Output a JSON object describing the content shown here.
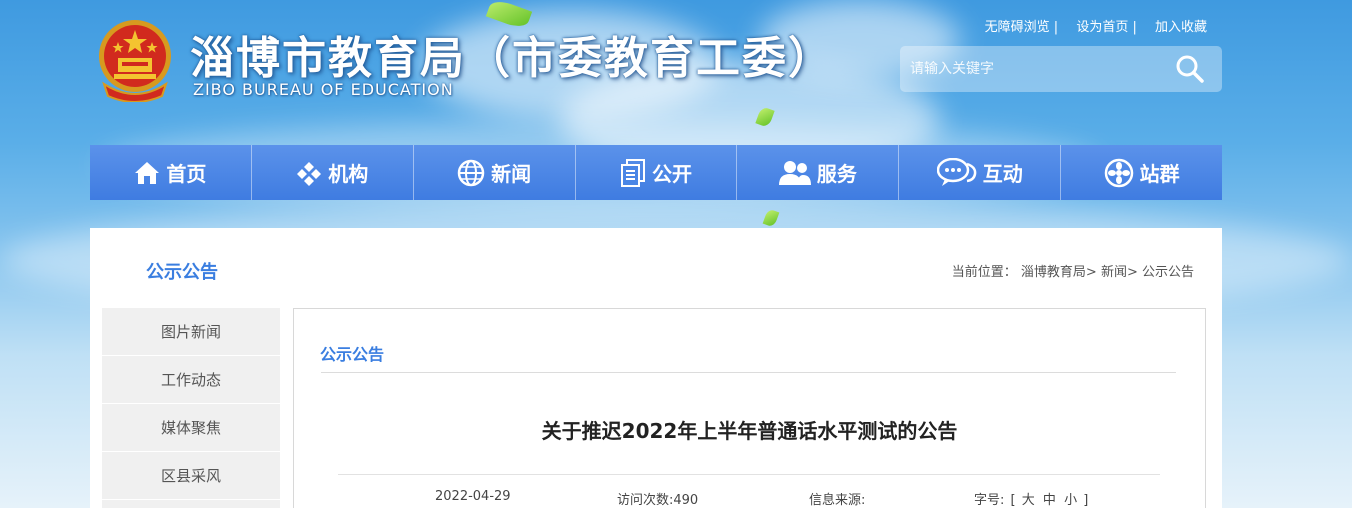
{
  "header": {
    "site_title": "淄博市教育局（市委教育工委）",
    "site_subtitle": "ZIBO BUREAU OF EDUCATION",
    "top_links": [
      "无障碍浏览 |",
      "设为首页 |",
      "加入收藏"
    ],
    "search_placeholder": "请输入关键字"
  },
  "nav": {
    "items": [
      {
        "label": "首页",
        "icon": "home-icon"
      },
      {
        "label": "机构",
        "icon": "org-icon"
      },
      {
        "label": "新闻",
        "icon": "globe-icon"
      },
      {
        "label": "公开",
        "icon": "document-icon"
      },
      {
        "label": "服务",
        "icon": "users-icon"
      },
      {
        "label": "互动",
        "icon": "chat-icon"
      },
      {
        "label": "站群",
        "icon": "sites-icon"
      }
    ]
  },
  "main": {
    "section_title": "公示公告",
    "breadcrumb": {
      "prefix": "当前位置：",
      "items": [
        "淄博教育局>",
        "新闻>",
        "公示公告"
      ]
    },
    "sidebar": [
      "图片新闻",
      "工作动态",
      "媒体聚焦",
      "区县采风"
    ],
    "content": {
      "column_title": "公示公告",
      "article_title": "关于推迟2022年上半年普通话水平测试的公告",
      "date": "2022-04-29",
      "visits": "访问次数:490",
      "source": "信息来源:",
      "font_size_label": "字号:",
      "font_size_open": "[",
      "font_size_options": [
        "大",
        "中",
        "小"
      ],
      "font_size_close": "]"
    }
  },
  "colors": {
    "accent": "#3a7ee0",
    "nav_bg": "#4a86e6"
  }
}
